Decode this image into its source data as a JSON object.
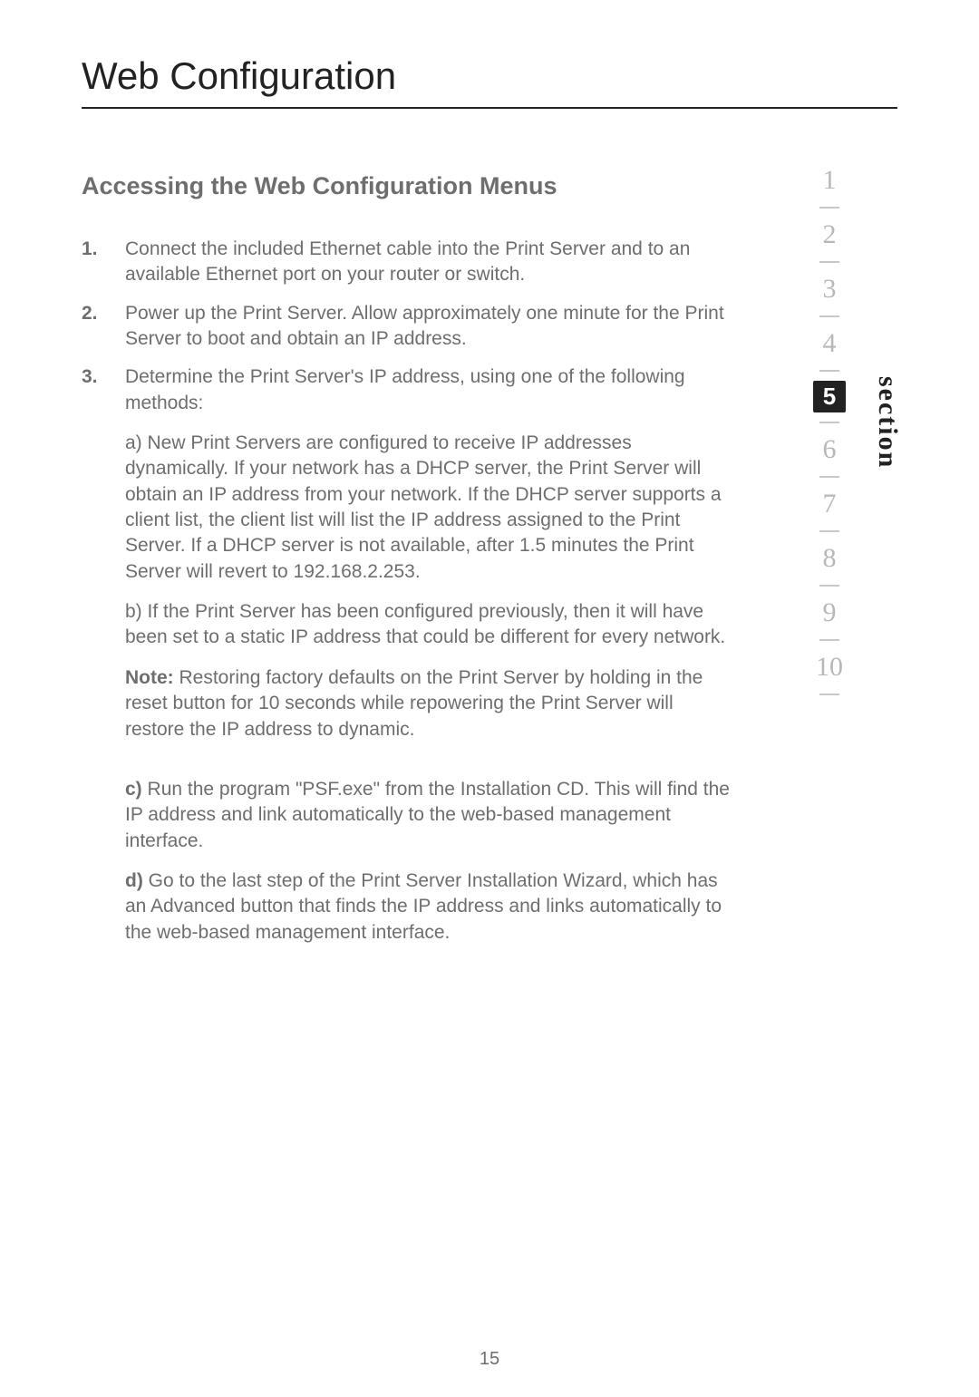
{
  "title": "Web Configuration",
  "subhead": "Accessing the Web Configuration Menus",
  "steps": [
    {
      "num": "1.",
      "paras": [
        {
          "text": "Connect the included Ethernet cable into the Print Server and to an available Ethernet port on your router or switch."
        }
      ]
    },
    {
      "num": "2.",
      "paras": [
        {
          "text": "Power up the Print Server. Allow approximately one minute for the Print Server to boot and obtain an IP address."
        }
      ]
    },
    {
      "num": "3.",
      "paras": [
        {
          "text": "Determine the Print Server's IP address, using one of the following methods:"
        },
        {
          "text": "a) New Print Servers are configured to receive IP addresses dynamically. If your network has a DHCP server, the Print Server will obtain an IP address from your network. If the DHCP server supports a client list, the client list will list the IP address assigned to the Print Server. If a DHCP server is not available, after 1.5 minutes the Print Server will revert to 192.168.2.253."
        },
        {
          "text": "b) If the Print Server has been configured previously, then it will have been set to a static IP address that could be different for every network."
        },
        {
          "lead_bold": "Note:",
          "text": " Restoring factory defaults on the Print Server by holding in the reset button for 10 seconds while repowering the Print Server will restore the IP address to dynamic."
        },
        {
          "spacer": true
        },
        {
          "lead_bold": "c)",
          "text": " Run the program \"PSF.exe\" from the Installation CD. This will find the IP address and link automatically to the web-based management interface."
        },
        {
          "lead_bold": "d)",
          "text": " Go to the last step of the Print Server Installation Wizard, which has an Advanced button that finds the IP address and links automatically to the web-based management interface."
        }
      ]
    }
  ],
  "sidebar": {
    "label": "section",
    "items": [
      {
        "n": "1",
        "active": false
      },
      {
        "n": "2",
        "active": false
      },
      {
        "n": "3",
        "active": false
      },
      {
        "n": "4",
        "active": false
      },
      {
        "n": "5",
        "active": true
      },
      {
        "n": "6",
        "active": false
      },
      {
        "n": "7",
        "active": false
      },
      {
        "n": "8",
        "active": false
      },
      {
        "n": "9",
        "active": false
      },
      {
        "n": "10",
        "active": false
      }
    ]
  },
  "page_number": "15"
}
